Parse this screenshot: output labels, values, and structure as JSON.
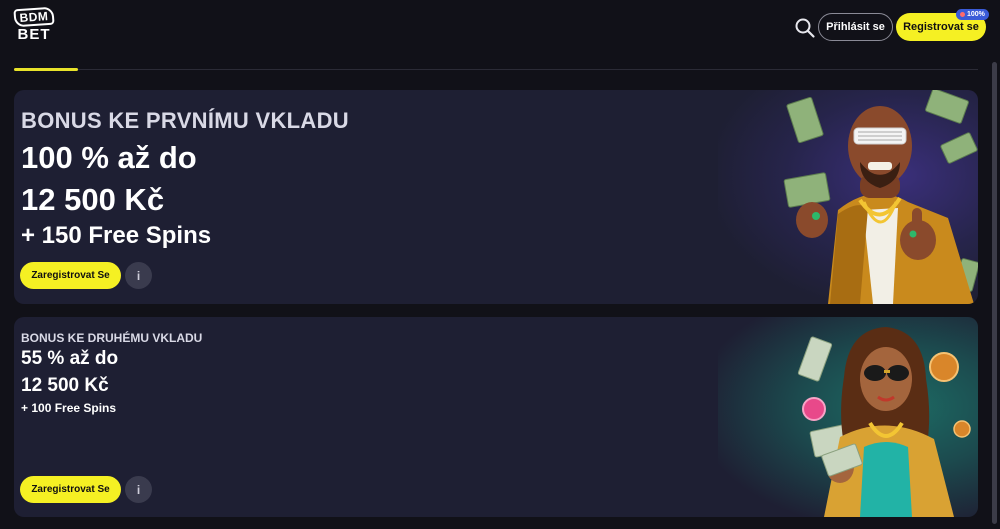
{
  "header": {
    "logo_top": "BDM",
    "logo_bottom": "BET",
    "login_label": "Přihlásit se",
    "register_label": "Registrovat se",
    "register_badge": "100%"
  },
  "icons": {
    "search": "search-icon",
    "info": "info-icon"
  },
  "colors": {
    "background": "#111118",
    "card": "#1e1f33",
    "accent_yellow": "#f5f023",
    "badge_blue": "#3a5bd8"
  },
  "promos": [
    {
      "title": "BONUS KE PRVNÍMU VKLADU",
      "percent_line": "100 % až do",
      "amount_line": "12 500 Kč",
      "spins_line": "+ 150 Free Spins",
      "cta_label": "Zaregistrovat Se",
      "info_label": "i"
    },
    {
      "title": "BONUS KE DRUHÉMU VKLADU",
      "percent_line": "55 % až do",
      "amount_line": "12 500 Kč",
      "spins_line": "+ 100 Free Spins",
      "cta_label": "Zaregistrovat Se",
      "info_label": "i"
    }
  ]
}
